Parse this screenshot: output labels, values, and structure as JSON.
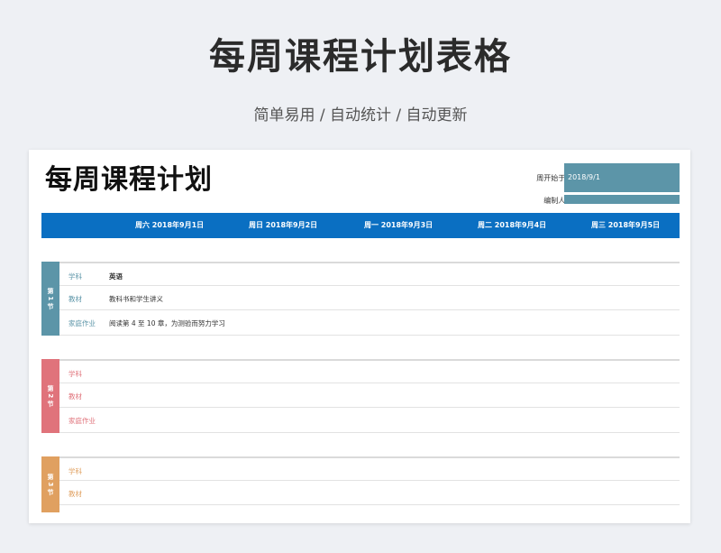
{
  "hero": {
    "title": "每周课程计划表格",
    "subtitle": "简单易用 / 自动统计 / 自动更新"
  },
  "sheet": {
    "title": "每周课程计划",
    "meta": {
      "start_label": "周开始于:",
      "start_value": "2018/9/1",
      "author_label": "编制人:",
      "author_value": ""
    },
    "days": [
      "周六 2018年9月1日",
      "周日 2018年9月2日",
      "周一 2018年9月3日",
      "周二 2018年9月4日",
      "周三 2018年9月5日"
    ],
    "sections": [
      {
        "tab": "第 1 节",
        "color": "#5c95a8",
        "rows": [
          {
            "label": "学科",
            "value": "英语",
            "bold": true
          },
          {
            "label": "教材",
            "value": "教科书和学生讲义"
          },
          {
            "label": "家庭作业",
            "value": "阅读第 4 至 10 章，为测验而努力学习"
          }
        ]
      },
      {
        "tab": "第 2 节",
        "color": "#e0737b",
        "rows": [
          {
            "label": "学科",
            "value": ""
          },
          {
            "label": "教材",
            "value": ""
          },
          {
            "label": "家庭作业",
            "value": ""
          }
        ]
      },
      {
        "tab": "第 3 节",
        "color": "#e0a060",
        "rows": [
          {
            "label": "学科",
            "value": ""
          },
          {
            "label": "教材",
            "value": ""
          }
        ]
      }
    ]
  }
}
